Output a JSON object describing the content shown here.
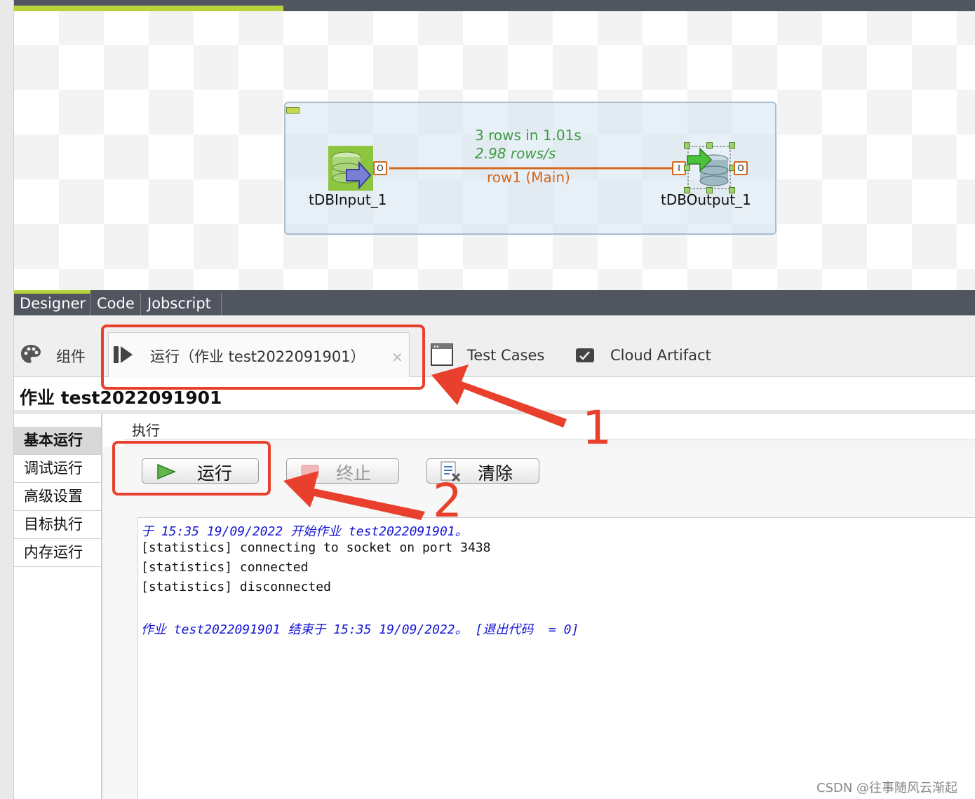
{
  "designer": {
    "components": {
      "input": {
        "label": "tDBInput_1",
        "out_port": "O"
      },
      "output": {
        "label": "tDBOutput_1",
        "in_port": "I",
        "out_port": "O"
      }
    },
    "connection": {
      "rows_stat": "3 rows in 1.01s",
      "rate_stat": "2.98 rows/s",
      "label": "row1 (Main)"
    },
    "progress_fraction": 0.28,
    "tabs": [
      "Designer",
      "Code",
      "Jobscript"
    ]
  },
  "view_tabs": {
    "components": "组件",
    "run": "运行（作业 test2022091901）",
    "run_close": "✕",
    "test_cases": "Test Cases",
    "cloud_artifact": "Cloud Artifact"
  },
  "job": {
    "title": "作业 test2022091901",
    "nav": [
      "基本运行",
      "调试运行",
      "高级设置",
      "目标执行",
      "内存运行"
    ],
    "exec_header": "执行",
    "buttons": {
      "run": "运行",
      "stop": "终止",
      "clear": "清除"
    }
  },
  "console": {
    "line1": "于 15:35 19/09/2022 开始作业 test2022091901。",
    "line2": "[statistics] connecting to socket on port 3438",
    "line3": "[statistics] connected",
    "line4": "[statistics] disconnected",
    "line5": "作业 test2022091901 结束于 15:35 19/09/2022。 [退出代码  = 0]"
  },
  "annotations": {
    "one": "1",
    "two": "2"
  },
  "watermark": "CSDN @往事随风云渐起",
  "colors": {
    "accent_green": "#b6d33c",
    "annotation_red": "#e8402c",
    "log_blue": "#1515d6",
    "connection_orange": "#d2671e"
  }
}
